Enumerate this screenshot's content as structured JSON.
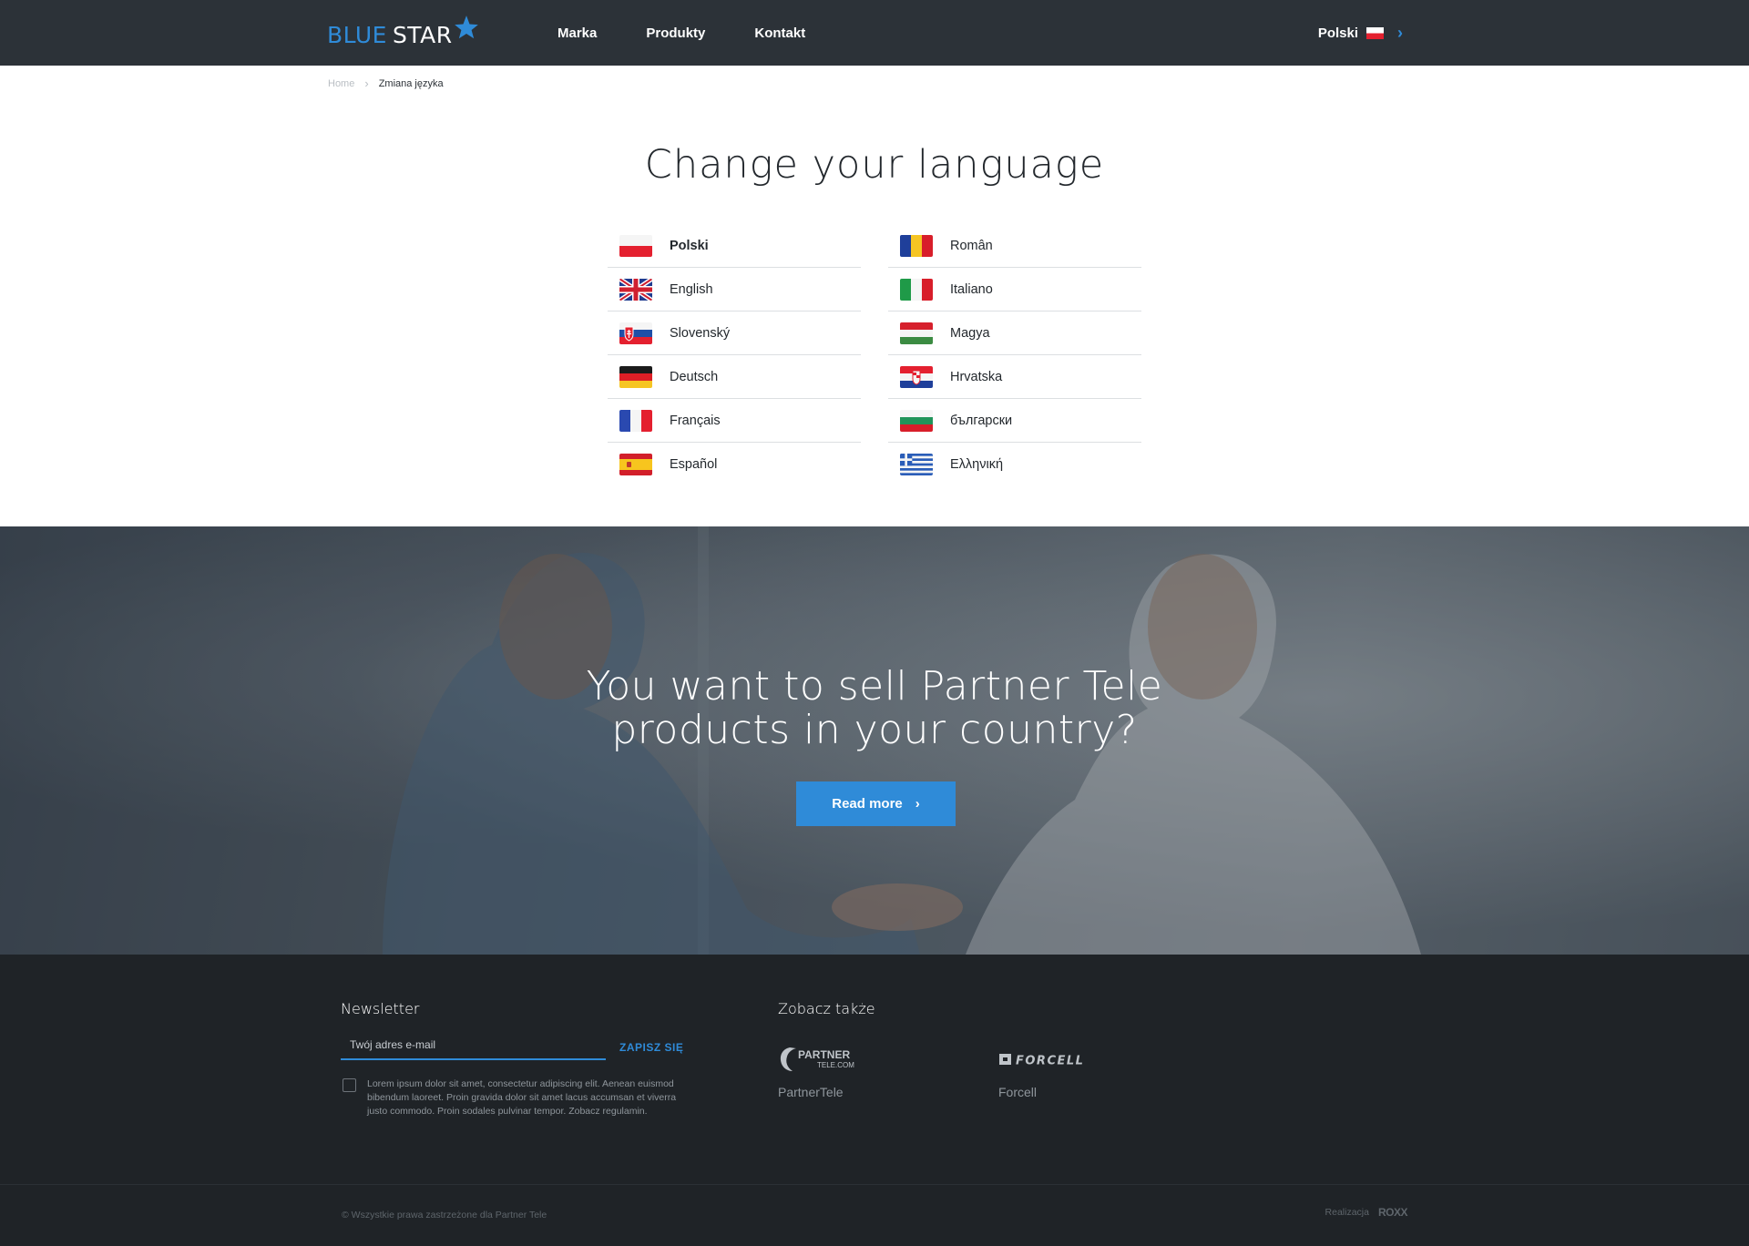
{
  "header": {
    "logo_left": "BLUE",
    "logo_right": "STAR",
    "nav": [
      "Marka",
      "Produkty",
      "Kontakt"
    ],
    "current_language": "Polski"
  },
  "breadcrumb": {
    "home": "Home",
    "current": "Zmiana języka"
  },
  "page_title": "Change your language",
  "languages": {
    "left": [
      {
        "label": "Polski",
        "flag": "pl-flag-icon",
        "active": true
      },
      {
        "label": "English",
        "flag": "uk-flag-icon"
      },
      {
        "label": "Slovenský",
        "flag": "sk-flag-icon"
      },
      {
        "label": "Deutsch",
        "flag": "de-flag-icon"
      },
      {
        "label": "Français",
        "flag": "fr-flag-icon"
      },
      {
        "label": "Español",
        "flag": "es-flag-icon"
      }
    ],
    "right": [
      {
        "label": "Român",
        "flag": "ro-flag-icon"
      },
      {
        "label": "Italiano",
        "flag": "it-flag-icon"
      },
      {
        "label": "Magya",
        "flag": "hu-flag-icon"
      },
      {
        "label": "Hrvatska",
        "flag": "hr-flag-icon"
      },
      {
        "label": "български",
        "flag": "bg-flag-icon"
      },
      {
        "label": "Ελληνική",
        "flag": "gr-flag-icon"
      }
    ]
  },
  "hero": {
    "title_line1": "You want to sell Partner Tele",
    "title_line2": "products in your country?",
    "button_label": "Read more"
  },
  "footer": {
    "newsletter_title": "Newsletter",
    "email_placeholder": "Twój adres e-mail",
    "submit_label": "ZAPISZ SIĘ",
    "consent_text": "Lorem ipsum dolor sit amet, consectetur adipiscing elit. Aenean euismod bibendum laoreet. Proin gravida dolor sit amet lacus accumsan et viverra justo commodo. Proin sodales pulvinar tempor. Zobacz regulamin.",
    "see_also_title": "Zobacz także",
    "partner_logo_line1": "PARTNER",
    "partner_logo_line2": "TELE.COM",
    "partner_name": "PartnerTele",
    "forcell_logo_text": "FORCELL",
    "forcell_name": "Forcell",
    "copyright": "© Wszystkie prawa zastrzeżone dla Partner Tele",
    "credits_label": "Realizacja",
    "credits_logo": "ROXX"
  },
  "colors": {
    "header_bg": "#2c3238",
    "accent_blue": "#2f8bd8",
    "footer_bg": "#1f2327",
    "divider": "#dcdfe2"
  }
}
